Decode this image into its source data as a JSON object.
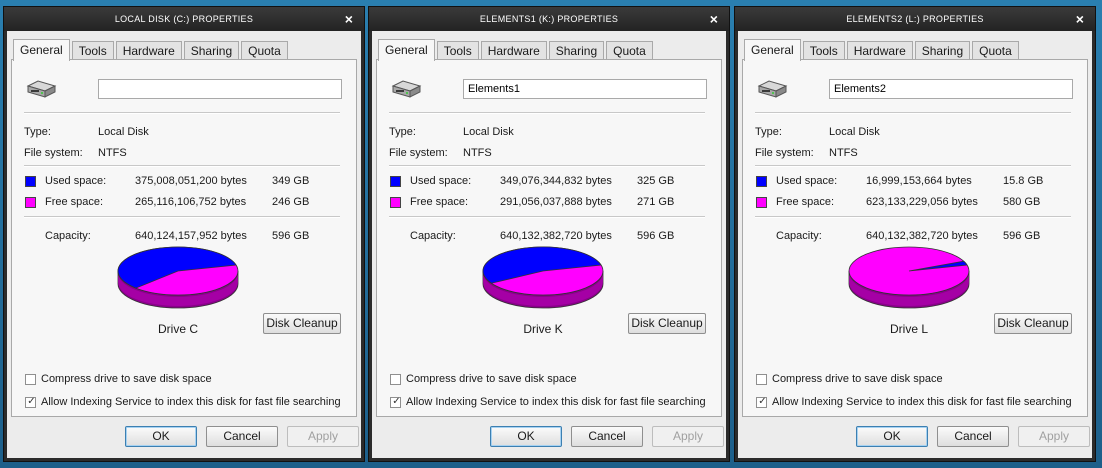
{
  "labels": {
    "tabs": [
      "General",
      "Tools",
      "Hardware",
      "Sharing",
      "Quota"
    ],
    "type_label": "Type:",
    "fs_label": "File system:",
    "used_label": "Used space:",
    "free_label": "Free space:",
    "capacity_label": "Capacity:",
    "disk_cleanup": "Disk Cleanup",
    "compress": "Compress drive to save disk space",
    "indexing": "Allow Indexing Service to index this disk for fast file searching",
    "ok": "OK",
    "cancel": "Cancel",
    "apply": "Apply",
    "close_glyph": "×"
  },
  "colors": {
    "used": "#0000ff",
    "free": "#ff00ff",
    "used_side": "#00007a",
    "free_side": "#8a008a"
  },
  "dialogs": [
    {
      "title": "LOCAL DISK (C:) PROPERTIES",
      "name": "",
      "type": "Local Disk",
      "fs": "NTFS",
      "used_bytes": "375,008,051,200 bytes",
      "used_gb": "349 GB",
      "free_bytes": "265,116,106,752 bytes",
      "free_gb": "246 GB",
      "cap_bytes": "640,124,157,952 bytes",
      "cap_gb": "596 GB",
      "drive_label": "Drive C",
      "used_fraction": 0.586,
      "compress_checked": false,
      "index_checked": true
    },
    {
      "title": "ELEMENTS1 (K:) PROPERTIES",
      "name": "Elements1",
      "type": "Local Disk",
      "fs": "NTFS",
      "used_bytes": "349,076,344,832 bytes",
      "used_gb": "325 GB",
      "free_bytes": "291,056,037,888 bytes",
      "free_gb": "271 GB",
      "cap_bytes": "640,132,382,720 bytes",
      "cap_gb": "596 GB",
      "drive_label": "Drive K",
      "used_fraction": 0.545,
      "compress_checked": false,
      "index_checked": true
    },
    {
      "title": "ELEMENTS2 (L:) PROPERTIES",
      "name": "Elements2",
      "type": "Local Disk",
      "fs": "NTFS",
      "used_bytes": "16,999,153,664 bytes",
      "used_gb": "15.8 GB",
      "free_bytes": "623,133,229,056 bytes",
      "free_gb": "580 GB",
      "cap_bytes": "640,132,382,720 bytes",
      "cap_gb": "596 GB",
      "drive_label": "Drive L",
      "used_fraction": 0.027,
      "compress_checked": false,
      "index_checked": true
    }
  ]
}
